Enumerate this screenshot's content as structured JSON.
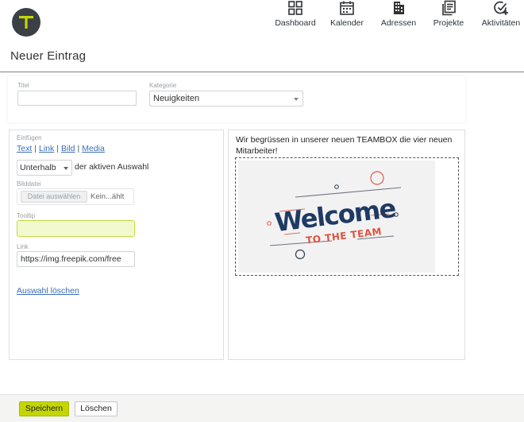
{
  "app": {
    "logo_letter": "T",
    "accent": "#c3d600",
    "logo_bg": "#3a4046"
  },
  "nav": {
    "items": [
      {
        "label": "Dashboard",
        "icon": "dashboard-icon"
      },
      {
        "label": "Kalender",
        "icon": "calendar-icon"
      },
      {
        "label": "Adressen",
        "icon": "building-icon"
      },
      {
        "label": "Projekte",
        "icon": "documents-icon"
      },
      {
        "label": "Aktivitäten",
        "icon": "check-add-icon"
      }
    ]
  },
  "page": {
    "title": "Neuer Eintrag"
  },
  "form": {
    "title_label": "Titel",
    "title_value": "",
    "category_label": "Kategorie",
    "category_value": "Neuigkeiten"
  },
  "insert": {
    "label": "Einfügen",
    "links": [
      "Text",
      "Link",
      "Bild",
      "Media"
    ],
    "position_value": "Unterhalb",
    "position_suffix": "der aktiven Auswahl",
    "file_label": "Bilddatei",
    "file_button": "Datei auswählen",
    "file_name": "Kein...ählt",
    "tooltip_label": "Tooltip",
    "tooltip_value": "",
    "link_label": "Link",
    "link_value": "https://img.freepik.com/free",
    "clear_label": "Auswahl löschen"
  },
  "preview": {
    "text": "Wir begrüssen in unserer neuen TEAMBOX die vier neuen Mitarbeiter!",
    "image_title": "Welcome",
    "image_subtitle": "TO THE TEAM"
  },
  "footer": {
    "save_label": "Speichern",
    "delete_label": "Löschen"
  }
}
